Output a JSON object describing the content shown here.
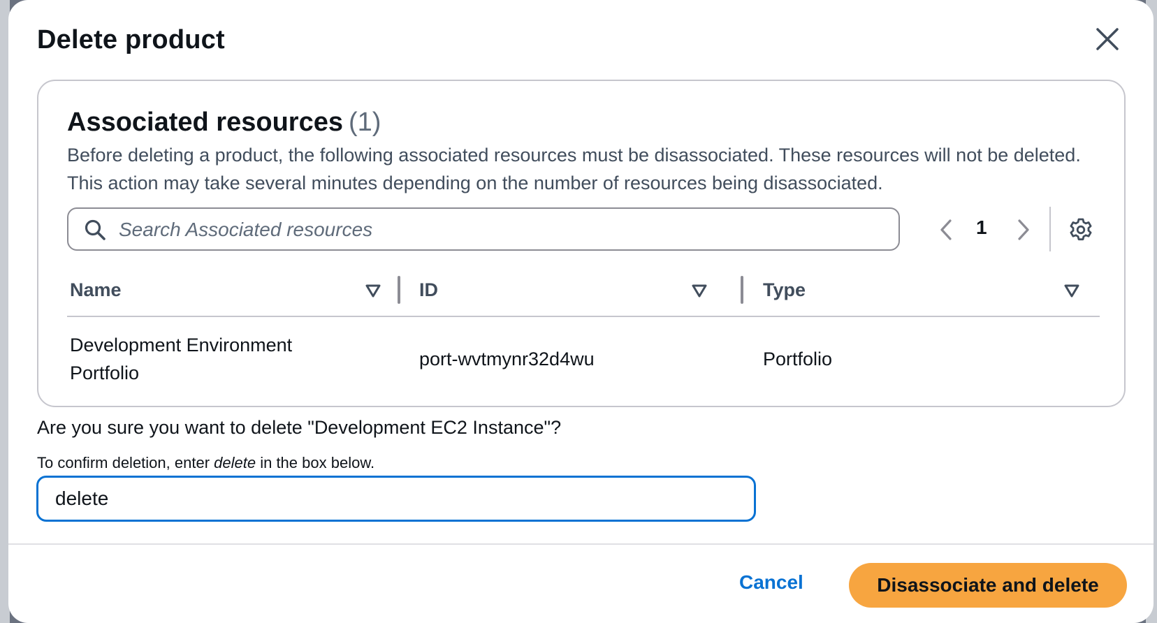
{
  "modal": {
    "title": "Delete product",
    "close_icon": "close-icon"
  },
  "associated_resources": {
    "title": "Associated resources",
    "count": "(1)",
    "description": "Before deleting a product, the following associated resources must be disassociated. These resources will not be deleted. This action may take several minutes depending on the number of resources being disassociated.",
    "search": {
      "placeholder": "Search Associated resources",
      "value": "",
      "icon": "search-icon"
    },
    "pagination": {
      "current_page": "1",
      "prev_icon": "chevron-left-icon",
      "next_icon": "chevron-right-icon"
    },
    "settings_icon": "gear-icon",
    "table": {
      "columns": [
        {
          "label": "Name",
          "sort_icon": "sort-down-icon"
        },
        {
          "label": "ID",
          "sort_icon": "sort-down-icon"
        },
        {
          "label": "Type",
          "sort_icon": "sort-down-icon"
        }
      ],
      "rows": [
        {
          "name": "Development Environment Portfolio",
          "id": "port-wvtmynr32d4wu",
          "type": "Portfolio"
        }
      ]
    }
  },
  "confirm": {
    "question": "Are you sure you want to delete \"Development EC2 Instance\"?",
    "hint_before": "To confirm deletion, enter ",
    "hint_keyword": "delete",
    "hint_after": " in the box below.",
    "input_value": "delete"
  },
  "footer": {
    "cancel_label": "Cancel",
    "primary_label": "Disassociate and delete",
    "primary_color": "#f7a540",
    "link_color": "#0972d3"
  }
}
